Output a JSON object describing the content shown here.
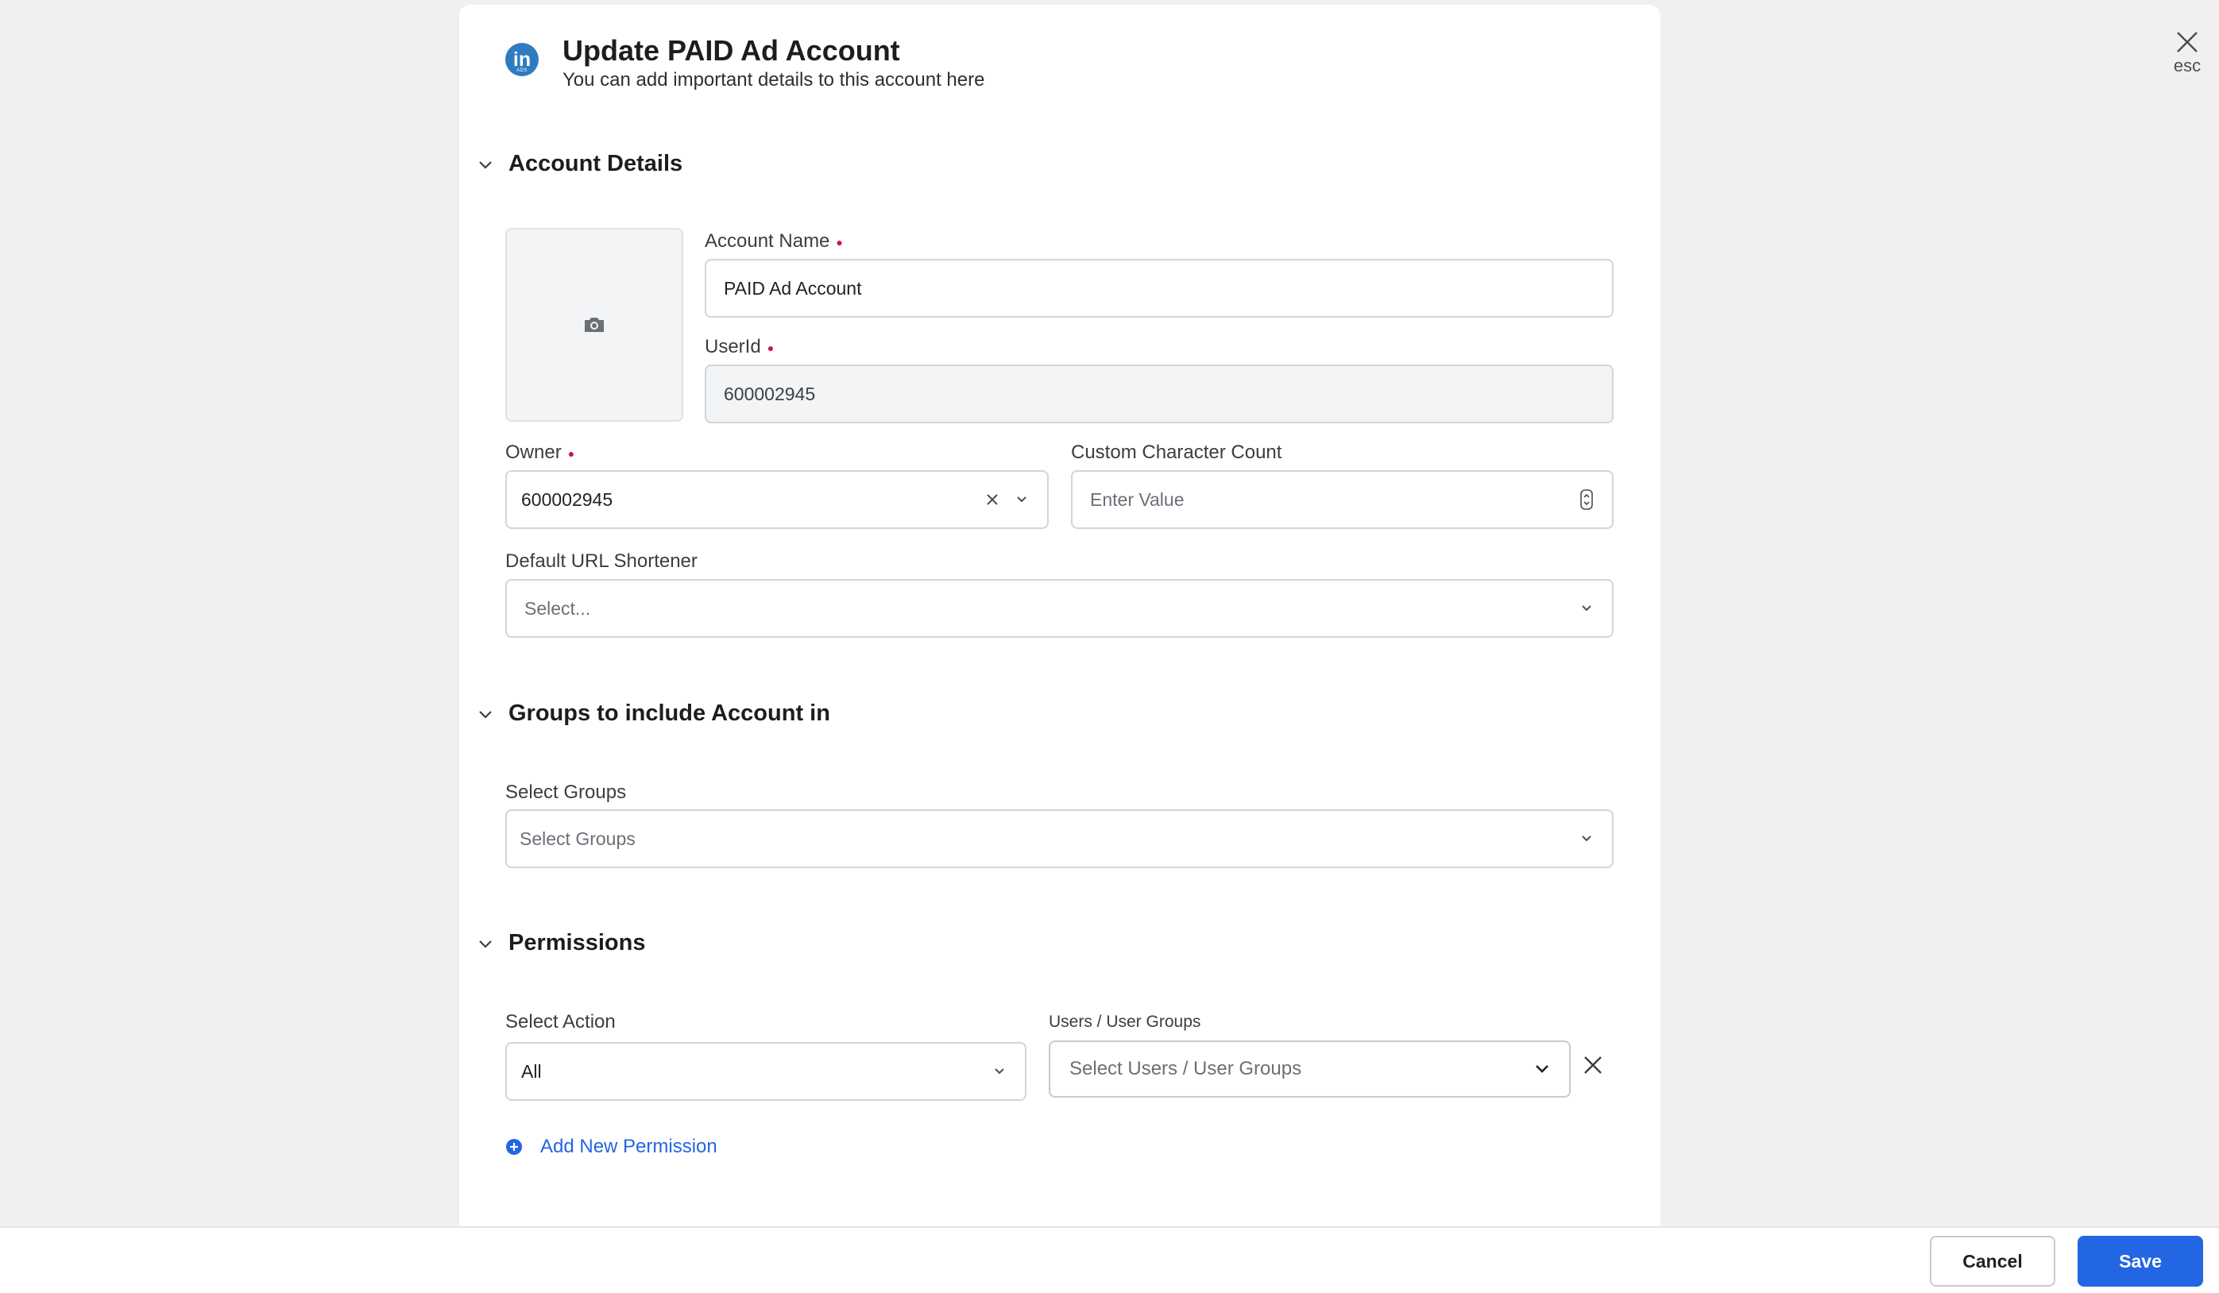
{
  "dialog": {
    "title": "Update PAID Ad Account",
    "subtitle": "You can add important details to this account here",
    "brand_icon": "linkedin-icon",
    "brand_icon_text": "in"
  },
  "close": {
    "label": "esc",
    "icon": "close-icon"
  },
  "sections": {
    "account_details": {
      "title": "Account Details",
      "account_name": {
        "label": "Account Name",
        "value": "PAID Ad Account"
      },
      "user_id": {
        "label": "UserId",
        "value": "600002945"
      },
      "owner": {
        "label": "Owner",
        "value": "600002945"
      },
      "custom_char_count": {
        "label": "Custom Character Count",
        "placeholder": "Enter Value"
      },
      "url_shortener": {
        "label": "Default URL Shortener",
        "placeholder": "Select..."
      }
    },
    "groups": {
      "title": "Groups to include Account in",
      "select_groups": {
        "label": "Select Groups",
        "placeholder": "Select Groups"
      }
    },
    "permissions": {
      "title": "Permissions",
      "select_action": {
        "label": "Select Action",
        "value": "All"
      },
      "users": {
        "label": "Users / User Groups",
        "placeholder": "Select Users / User Groups"
      },
      "add_new": "Add New Permission"
    }
  },
  "footer": {
    "cancel": "Cancel",
    "save": "Save"
  },
  "colors": {
    "accent": "#2266e3",
    "required": "#d0104c",
    "brand": "#2f7bbf"
  }
}
